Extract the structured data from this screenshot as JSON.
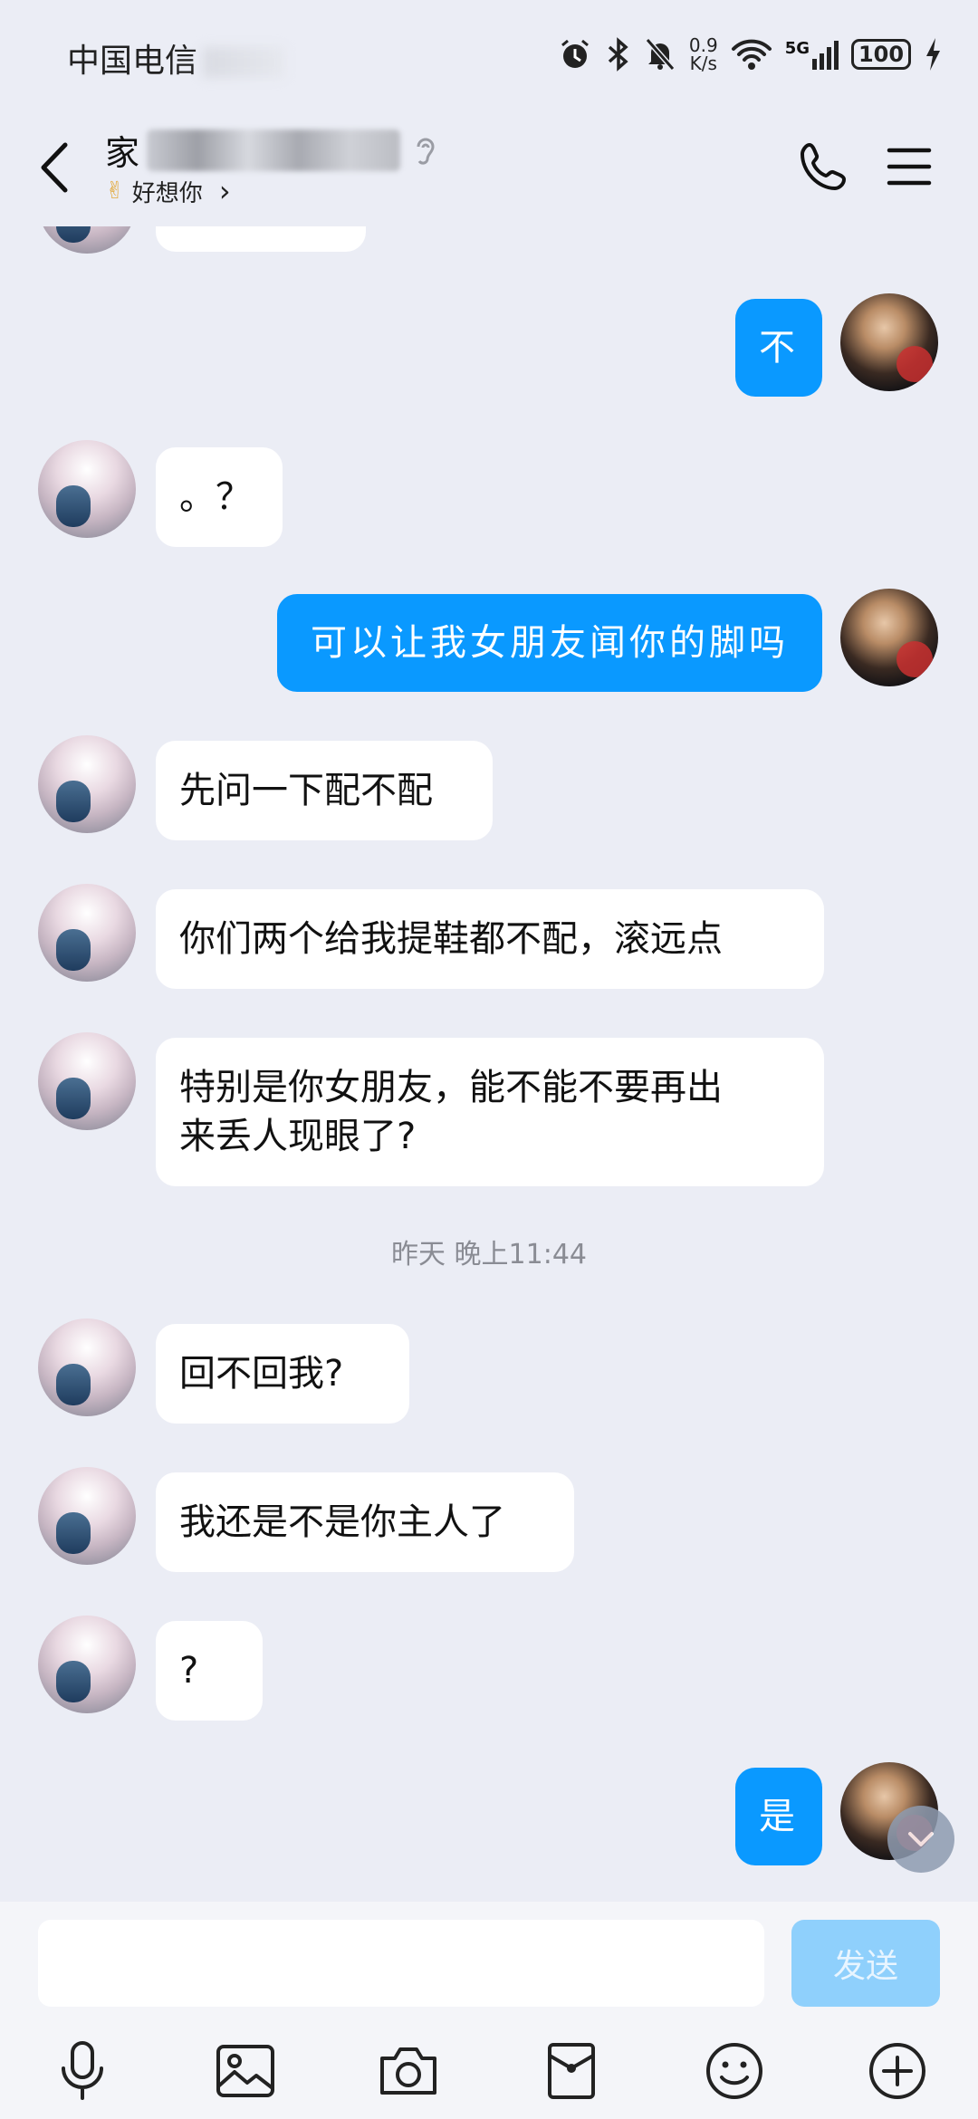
{
  "status_bar": {
    "carrier": "中国电信",
    "net_speed_value": "0.9",
    "net_speed_unit": "K/s",
    "network_type": "5G",
    "battery": "100"
  },
  "header": {
    "name_visible": "家",
    "status_emoji": "✌",
    "status_text": "好想你",
    "status_chevron": "›"
  },
  "messages": [
    {
      "side": "right",
      "text": "不"
    },
    {
      "side": "left",
      "text": "。？"
    },
    {
      "side": "right",
      "text": "可以让我女朋友闻你的脚吗"
    },
    {
      "side": "left",
      "text": "先问一下配不配"
    },
    {
      "side": "left",
      "text": "你们两个给我提鞋都不配，滚远点"
    },
    {
      "side": "left",
      "line1": "特别是你女朋友，能不能不要再出",
      "line2": "来丢人现眼了?"
    },
    {
      "type": "time",
      "text": "昨天 晚上11:44"
    },
    {
      "side": "left",
      "text": "回不回我?"
    },
    {
      "side": "left",
      "text": "我还是不是你主人了"
    },
    {
      "side": "left",
      "text": "?"
    },
    {
      "side": "right",
      "text": "是"
    }
  ],
  "input": {
    "placeholder": "",
    "send_label": "发送"
  },
  "colors": {
    "background": "#ebedf5",
    "bubble_self": "#0a99ff",
    "bubble_other": "#ffffff",
    "send_disabled": "#8fd0fc"
  },
  "toolbar_icons": [
    "microphone-icon",
    "image-icon",
    "camera-icon",
    "red-packet-icon",
    "emoji-icon",
    "plus-icon"
  ]
}
